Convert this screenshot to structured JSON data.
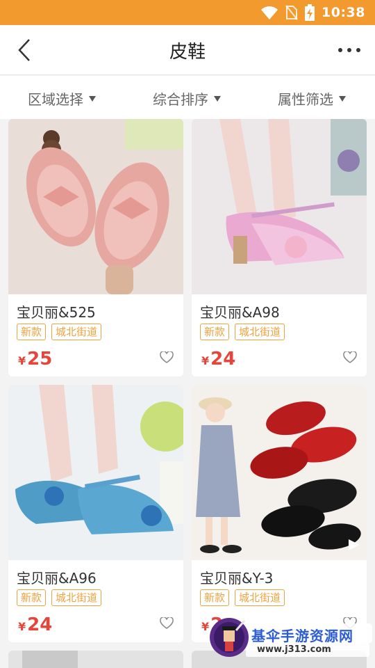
{
  "status_bar": {
    "time": "10:38"
  },
  "nav": {
    "title": "皮鞋"
  },
  "filters": [
    {
      "label": "区域选择"
    },
    {
      "label": "综合排序"
    },
    {
      "label": "属性筛选"
    }
  ],
  "products": [
    {
      "name": "宝贝丽&525",
      "tags": [
        "新款",
        "城北街道"
      ],
      "currency": "¥",
      "price": "25"
    },
    {
      "name": "宝贝丽&A98",
      "tags": [
        "新款",
        "城北街道"
      ],
      "currency": "¥",
      "price": "24"
    },
    {
      "name": "宝贝丽&A96",
      "tags": [
        "新款",
        "城北街道"
      ],
      "currency": "¥",
      "price": "24"
    },
    {
      "name": "宝贝丽&Y-3",
      "tags": [
        "新款",
        "城北街道"
      ],
      "currency": "¥",
      "price": "2"
    }
  ],
  "watermark": {
    "text": "基伞手游资源网",
    "url": "www.j313.com"
  },
  "colors": {
    "status_bar": "#f29a2e",
    "tag": "#f0a23c",
    "price": "#e6453b"
  }
}
